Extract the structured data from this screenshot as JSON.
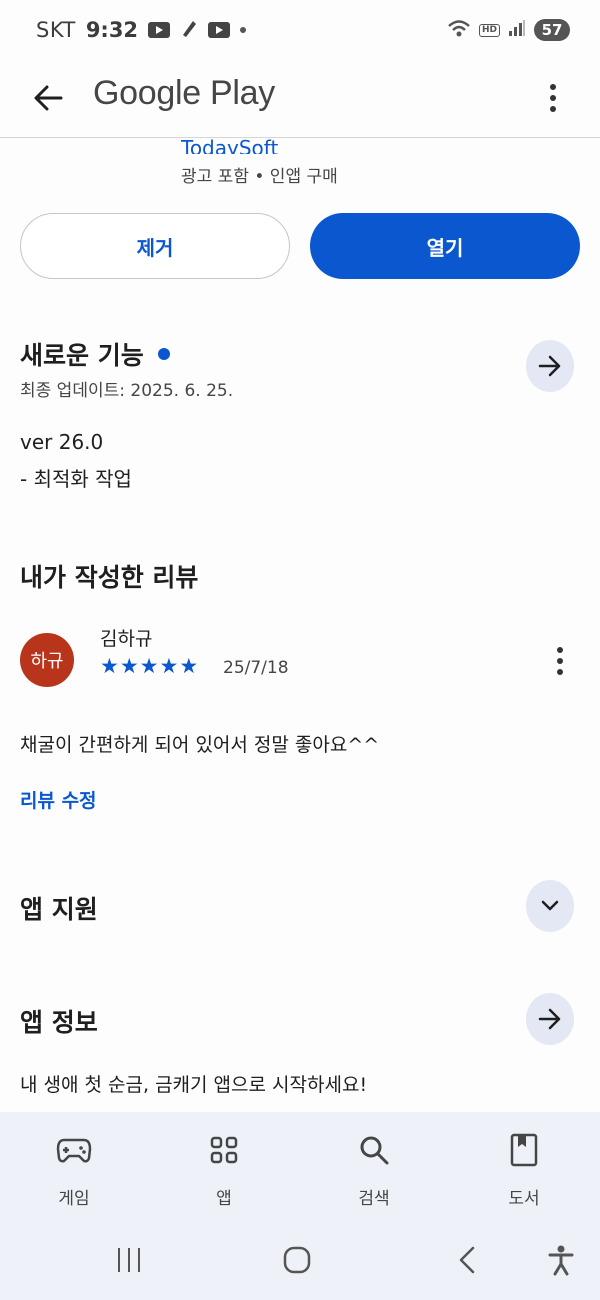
{
  "status_bar": {
    "carrier": "SKT",
    "time": "9:32",
    "hd_label": "HD",
    "battery": "57"
  },
  "app_bar": {
    "title": "Google Play"
  },
  "app": {
    "developer": "TodaySoft",
    "tags": "광고 포함 • 인앱 구매"
  },
  "actions": {
    "remove_label": "제거",
    "open_label": "열기"
  },
  "whats_new": {
    "title": "새로운 기능",
    "last_updated": "최종 업데이트: 2025. 6. 25.",
    "version": "ver 26.0",
    "notes": "- 최적화 작업"
  },
  "my_review": {
    "title": "내가 작성한 리뷰",
    "avatar_text": "하규",
    "reviewer": "김하규",
    "rating": 5,
    "date": "25/7/18",
    "text": "채굴이 간편하게 되어 있어서 정말 좋아요^^",
    "edit_label": "리뷰 수정"
  },
  "app_support": {
    "title": "앱 지원"
  },
  "app_info": {
    "title": "앱 정보",
    "description": "내 생애 첫 순금, 금캐기 앱으로 시작하세요!"
  },
  "bottom_nav": {
    "items": [
      {
        "label": "게임",
        "icon": "gamepad-icon"
      },
      {
        "label": "앱",
        "icon": "apps-grid-icon"
      },
      {
        "label": "검색",
        "icon": "search-icon"
      },
      {
        "label": "도서",
        "icon": "book-icon"
      }
    ]
  },
  "colors": {
    "accent": "#0b57d0",
    "avatar": "#b8351b",
    "nav_bg": "#eef2f8"
  }
}
